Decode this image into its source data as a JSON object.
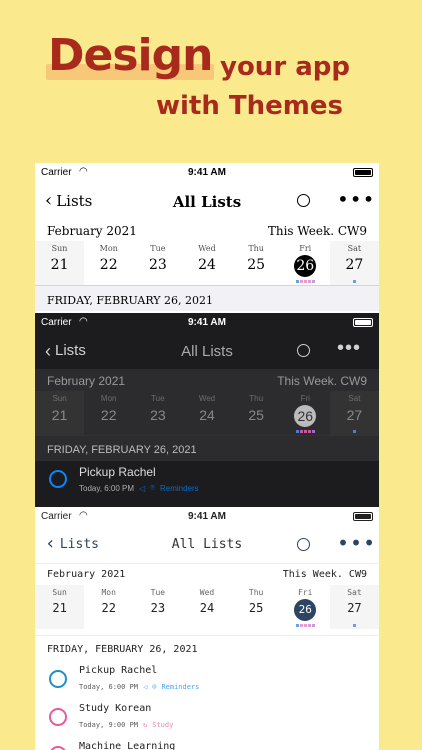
{
  "headline": {
    "word1": "Design",
    "word2": "your app",
    "line2": "with Themes"
  },
  "status": {
    "carrier": "Carrier",
    "time": "9:41 AM"
  },
  "nav": {
    "back": "Lists",
    "title": "All Lists"
  },
  "week": {
    "month": "February 2021",
    "cw": "This Week. CW9",
    "days": [
      {
        "name": "Sun",
        "date": "21"
      },
      {
        "name": "Mon",
        "date": "22"
      },
      {
        "name": "Tue",
        "date": "23"
      },
      {
        "name": "Wed",
        "date": "24"
      },
      {
        "name": "Thu",
        "date": "25"
      },
      {
        "name": "Fri",
        "date": "26"
      },
      {
        "name": "Sat",
        "date": "27"
      }
    ]
  },
  "section_date": "FRIDAY, FEBRUARY 26, 2021",
  "section_date_alt": "FRIDAY, FEBRUARY 26, 2021",
  "tasks": [
    {
      "title": "Pickup Rachel",
      "time": "Today, 6:00 PM",
      "list": "Reminders",
      "color": "#0a84ff"
    },
    {
      "title": "Study Korean",
      "time": "Today, 9:00 PM",
      "list": "Study",
      "color": "#e85a9a"
    },
    {
      "title": "Machine Learning",
      "time": "",
      "list": "",
      "color": "#e85a9a"
    }
  ],
  "colors": {
    "background": "#fbe98d",
    "headline": "#a82a1c",
    "accent": "#0a84ff",
    "dark_bg": "#1c1c1e",
    "selected_dark": "#2d4563"
  }
}
